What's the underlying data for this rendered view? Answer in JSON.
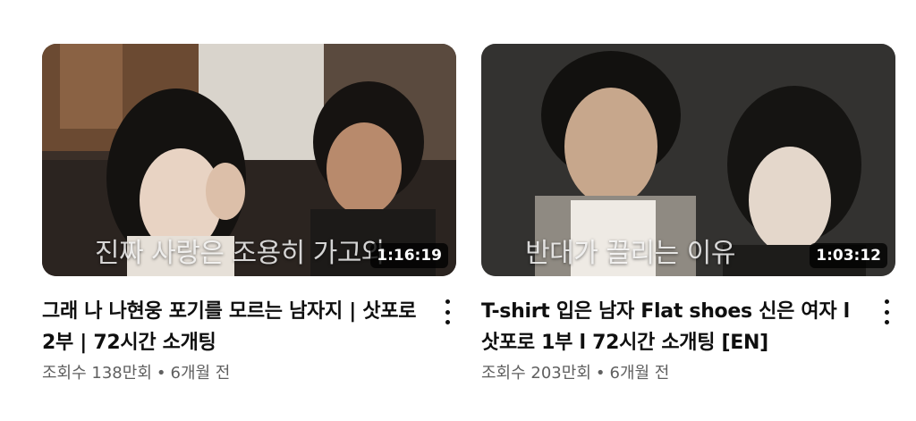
{
  "videos": [
    {
      "thumbnail_caption": "진짜 사랑은 조용히 가고와",
      "duration": "1:16:19",
      "title": "그래 나 나현웅 포기를 모르는 남자지 | 삿포로 2부 | 72시간 소개팅",
      "views": "조회수 138만회",
      "separator": "•",
      "age": "6개월 전",
      "menu_icon": "more-vert-icon"
    },
    {
      "thumbnail_caption": "반대가 끌리는 이유",
      "duration": "1:03:12",
      "title": "T-shirt 입은 남자 Flat shoes 신은 여자 l 삿포로 1부 l 72시간 소개팅 [EN]",
      "views": "조회수 203만회",
      "separator": "•",
      "age": "6개월 전",
      "menu_icon": "more-vert-icon"
    }
  ],
  "colors": {
    "title_text": "#0f0f0f",
    "meta_text": "#606060",
    "duration_bg": "#000000"
  }
}
